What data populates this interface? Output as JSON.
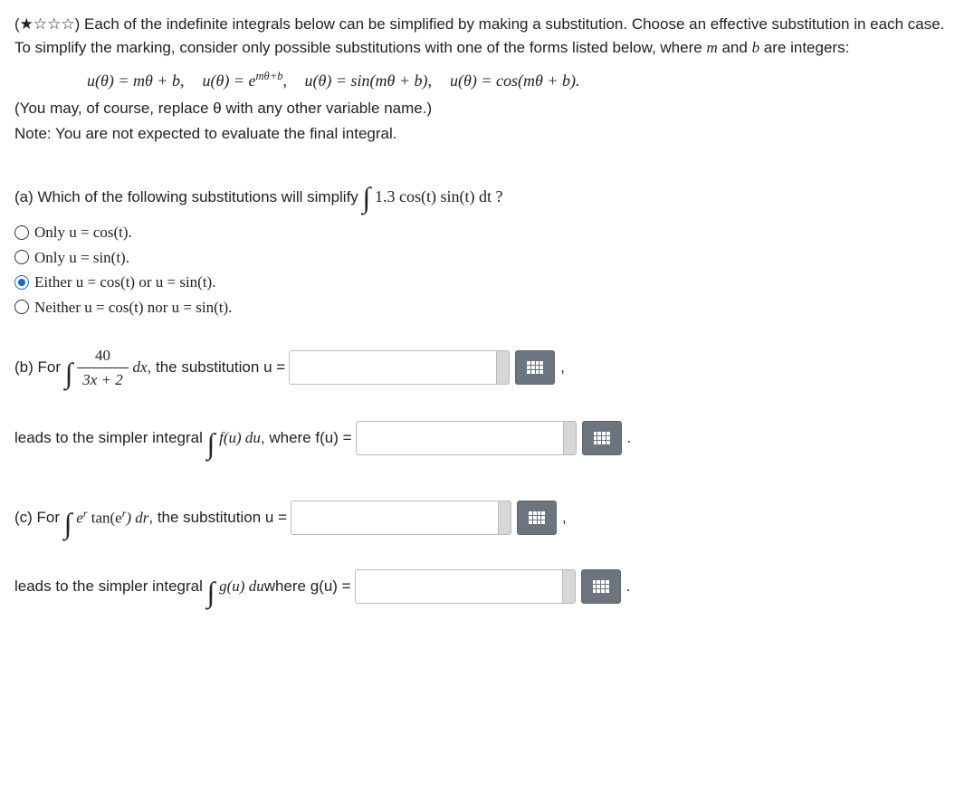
{
  "difficulty": {
    "stars": "(★☆☆☆)"
  },
  "intro": {
    "line1": "Each of the indefinite integrals below can be simplified by making a substitution. Choose an effective substitution in each case. To simplify the marking, consider only possible substitutions with one of the forms listed below, where",
    "mvar": "m",
    "and": "and",
    "bvar": "b",
    "line1_end": "are integers:"
  },
  "forms": {
    "f1_lhs": "u(θ) = mθ + b,",
    "f2_lhs": "u(θ) = e",
    "f2_exp": "mθ+b",
    "f2_comma": ",",
    "f3": "u(θ) = sin(mθ + b),",
    "f4": "u(θ) = cos(mθ + b)."
  },
  "paren_note": "(You may, of course, replace θ with any other variable name.)",
  "note": "Note: You are not expected to evaluate the final integral.",
  "part_a": {
    "prefix": "(a) Which of the following substitutions will simplify",
    "integrand": "1.3 cos(t) sin(t) dt ?",
    "options": {
      "o1_text": "Only u = cos(t).",
      "o2_text": "Only u = sin(t).",
      "o3_text": "Either u = cos(t) or u = sin(t).",
      "o4_text": "Neither u = cos(t) nor u = sin(t)."
    },
    "selected_index": 2
  },
  "part_b": {
    "prefix": "(b) For",
    "frac_num": "40",
    "frac_den": "3x + 2",
    "dx": "dx",
    "sub_text": ", the substitution  u =",
    "after_comma": ",",
    "leads": "leads to the simpler integral",
    "fu": "f(u) du",
    "where": ", where  f(u) =",
    "period": "."
  },
  "part_c": {
    "prefix": "(c) For",
    "integrand_pre": "e",
    "exp": "r",
    "integrand_post": " tan(e",
    "exp2": "r",
    "integrand_end": ") dr",
    "sub_text": ", the substitution  u =",
    "after_comma": ",",
    "leads": "leads to the simpler integral",
    "gu": "g(u) du",
    "where": "  where  g(u) =",
    "period": "."
  }
}
